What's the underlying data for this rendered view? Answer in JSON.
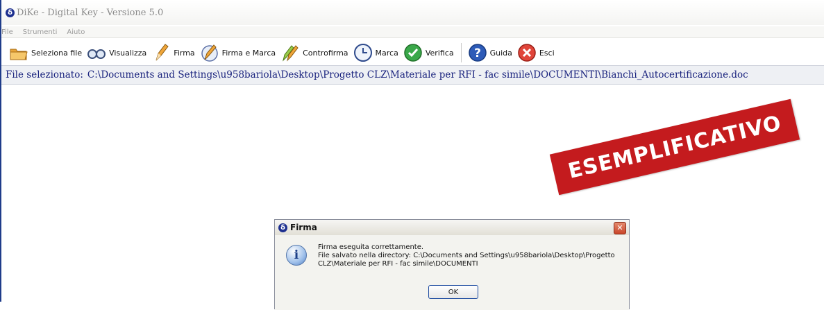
{
  "window": {
    "title": "DiKe - Digital Key - Versione 5.0",
    "app_icon_glyph": "δ"
  },
  "menu": [
    "File",
    "Strumenti",
    "Aiuto"
  ],
  "toolbar": {
    "seleziona": "Seleziona file",
    "visualizza": "Visualizza",
    "firma": "Firma",
    "firma_marca": "Firma e Marca",
    "controfirma": "Controfirma",
    "marca": "Marca",
    "verifica": "Verifica",
    "guida": "Guida",
    "esci": "Esci"
  },
  "file_bar": {
    "prefix": "File selezionato:",
    "path": "C:\\Documents and Settings\\u958bariola\\Desktop\\Progetto CLZ\\Materiale per RFI - fac simile\\DOCUMENTI\\Bianchi_Autocertificazione.doc"
  },
  "stamp": {
    "text": "ESEMPLIFICATIVO",
    "color": "#c41b1e"
  },
  "dialog": {
    "title": "Firma",
    "close_glyph": "✕",
    "line1": "Firma eseguita correttamente.",
    "line2": "File salvato nella directory: C:\\Documents and Settings\\u958bariola\\Desktop\\Progetto",
    "line3": "CLZ\\Materiale per RFI - fac simile\\DOCUMENTI",
    "ok": "OK",
    "info_glyph": "i"
  }
}
